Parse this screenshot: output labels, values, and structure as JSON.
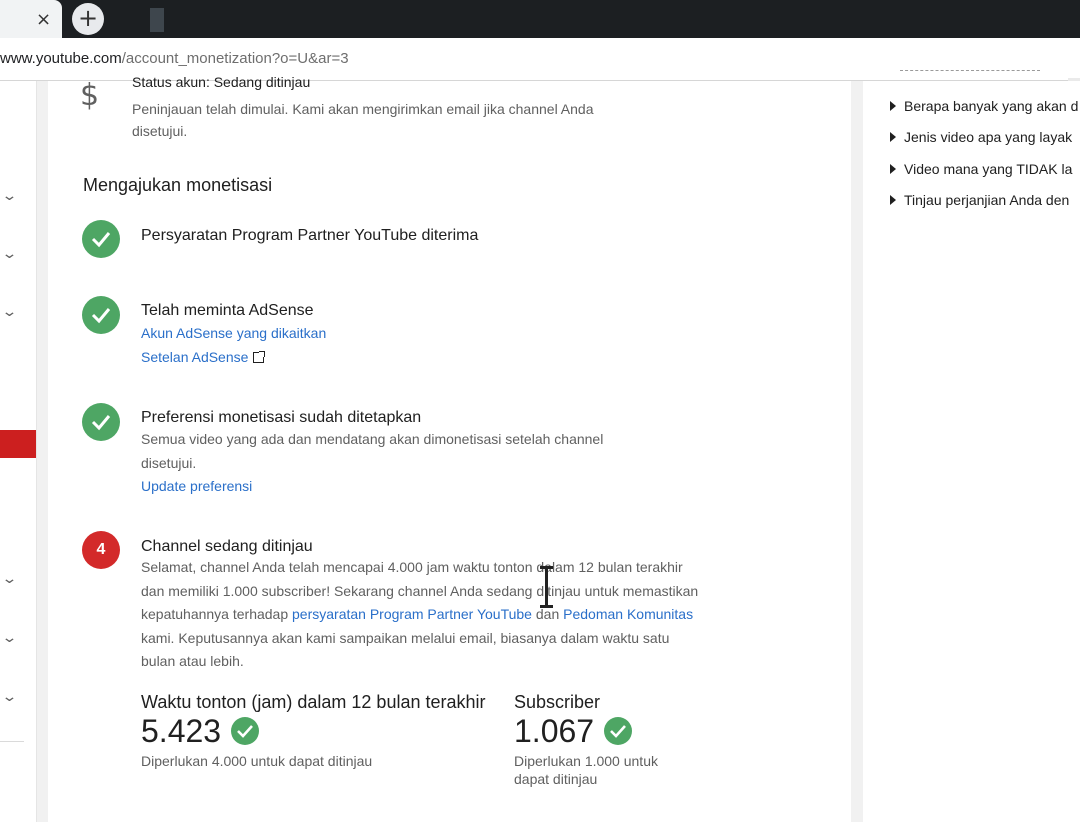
{
  "browser": {
    "tab_close": "×",
    "new_tab": "+",
    "url_domain": "www.youtube.com",
    "url_path": "/account_monetization?o=U&ar=3"
  },
  "status": {
    "icon": "dollar-icon",
    "title": "Status akun: Sedang ditinjau",
    "description": "Peninjauan telah dimulai. Kami akan mengirimkan email jika channel Anda disetujui."
  },
  "monetization": {
    "section_title": "Mengajukan monetisasi",
    "steps": [
      {
        "title": "Persyaratan Program Partner YouTube diterima"
      },
      {
        "title": "Telah meminta AdSense",
        "link1": "Akun AdSense yang dikaitkan",
        "link2": "Setelan AdSense"
      },
      {
        "title": "Preferensi monetisasi sudah ditetapkan",
        "text": "Semua video yang ada dan mendatang akan dimonetisasi setelah channel disetujui.",
        "link": "Update preferensi"
      },
      {
        "number": "4",
        "title": "Channel sedang ditinjau",
        "text_part1": "Selamat, channel Anda telah mencapai 4.000 jam waktu tonton dalam 12 bulan terakhir dan memiliki 1.000 subscriber! Sekarang channel Anda sedang ditinjau untuk memastikan kepatuhannya terhadap ",
        "link_ypp": "persyaratan Program Partner YouTube",
        "text_part2": " dan ",
        "link_guidelines": "Pedoman Komunitas",
        "text_part3": " kami. Keputusannya akan kami sampaikan melalui email, biasanya dalam waktu satu bulan atau lebih."
      }
    ],
    "metrics": [
      {
        "label": "Waktu tonton (jam) dalam 12 bulan terakhir",
        "value": "5.423",
        "note": "Diperlukan 4.000 untuk dapat ditinjau"
      },
      {
        "label": "Subscriber",
        "value": "1.067",
        "note": "Diperlukan 1.000 untuk dapat ditinjau"
      }
    ]
  },
  "help": {
    "items": [
      "Berapa banyak yang akan d",
      "Jenis video apa yang layak",
      "Video mana yang TIDAK la",
      "Tinjau perjanjian Anda den"
    ]
  },
  "colors": {
    "success": "#4ea664",
    "alert": "#d32a2a",
    "link": "#2a6fc9",
    "brand_red": "#cc1f1f"
  }
}
